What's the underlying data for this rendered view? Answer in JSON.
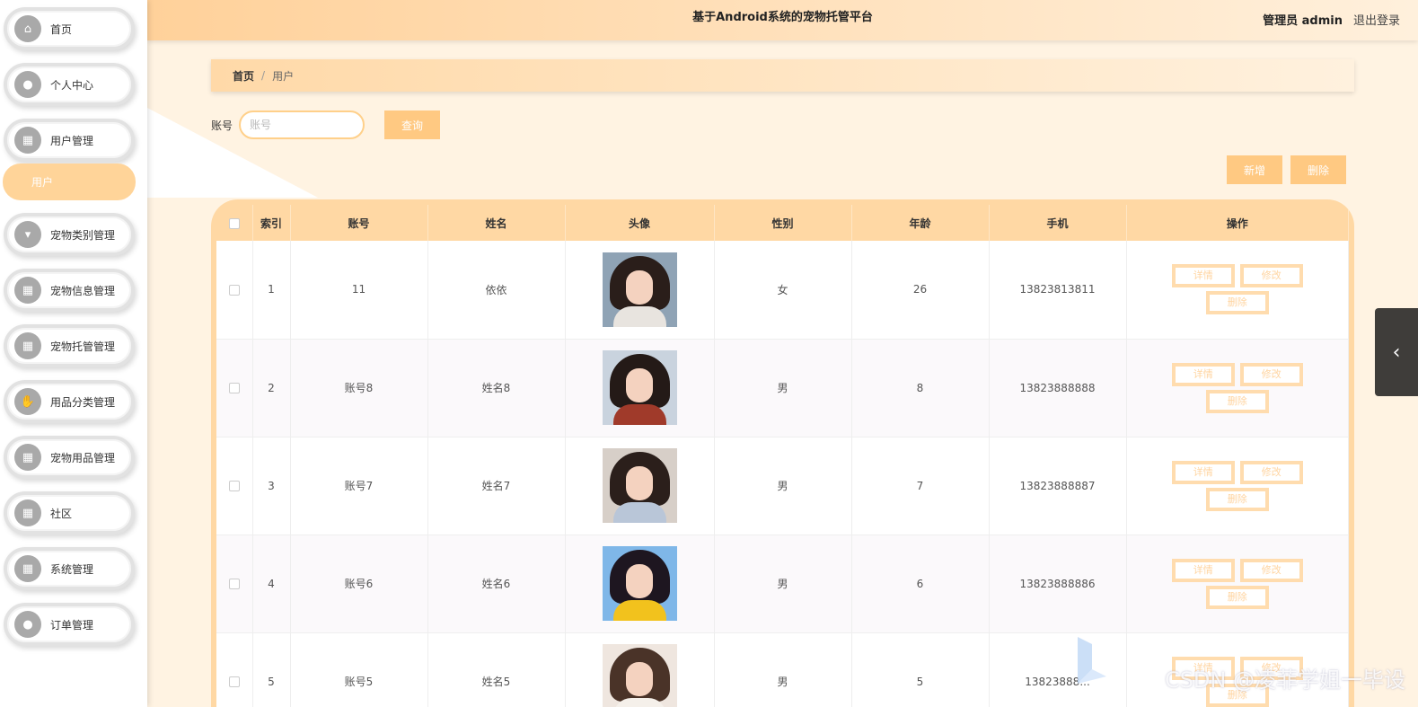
{
  "header": {
    "title": "基于Android系统的宠物托管平台",
    "user": "管理员 admin",
    "logout": "退出登录"
  },
  "sidebar": {
    "items": [
      {
        "label": "首页",
        "icon": "home-icon"
      },
      {
        "label": "个人中心",
        "icon": "user-icon"
      },
      {
        "label": "用户管理",
        "icon": "grid-icon"
      },
      {
        "label": "宠物类别管理",
        "icon": "tag-icon"
      },
      {
        "label": "宠物信息管理",
        "icon": "grid-icon"
      },
      {
        "label": "宠物托管管理",
        "icon": "grid-icon"
      },
      {
        "label": "用品分类管理",
        "icon": "thumb-icon"
      },
      {
        "label": "宠物用品管理",
        "icon": "grid-icon"
      },
      {
        "label": "社区",
        "icon": "grid-icon"
      },
      {
        "label": "系统管理",
        "icon": "grid-icon"
      },
      {
        "label": "订单管理",
        "icon": "person-icon"
      }
    ],
    "submenu": {
      "label": "用户"
    }
  },
  "breadcrumb": {
    "home": "首页",
    "separator": "/",
    "current": "用户"
  },
  "search": {
    "label": "账号",
    "placeholder": "账号",
    "button": "查询"
  },
  "actions": {
    "add": "新增",
    "delete": "删除"
  },
  "table": {
    "headers": [
      "索引",
      "账号",
      "姓名",
      "头像",
      "性别",
      "年龄",
      "手机",
      "操作"
    ],
    "op_labels": {
      "detail": "详情",
      "edit": "修改",
      "delete": "删除"
    },
    "rows": [
      {
        "index": "1",
        "account": "11",
        "name": "依依",
        "gender": "女",
        "age": "26",
        "phone": "13823813811"
      },
      {
        "index": "2",
        "account": "账号8",
        "name": "姓名8",
        "gender": "男",
        "age": "8",
        "phone": "13823888888"
      },
      {
        "index": "3",
        "account": "账号7",
        "name": "姓名7",
        "gender": "男",
        "age": "7",
        "phone": "13823888887"
      },
      {
        "index": "4",
        "account": "账号6",
        "name": "姓名6",
        "gender": "男",
        "age": "6",
        "phone": "13823888886"
      },
      {
        "index": "5",
        "account": "账号5",
        "name": "姓名5",
        "gender": "男",
        "age": "5",
        "phone": "13823888..."
      }
    ]
  },
  "watermark": "CSDN @凌菲学姐一毕设",
  "colors": {
    "accent": "#ffc982",
    "header_gradient_start": "#ffd19a",
    "table_header": "#ffd8a4",
    "submenu_active": "#ffd499"
  }
}
